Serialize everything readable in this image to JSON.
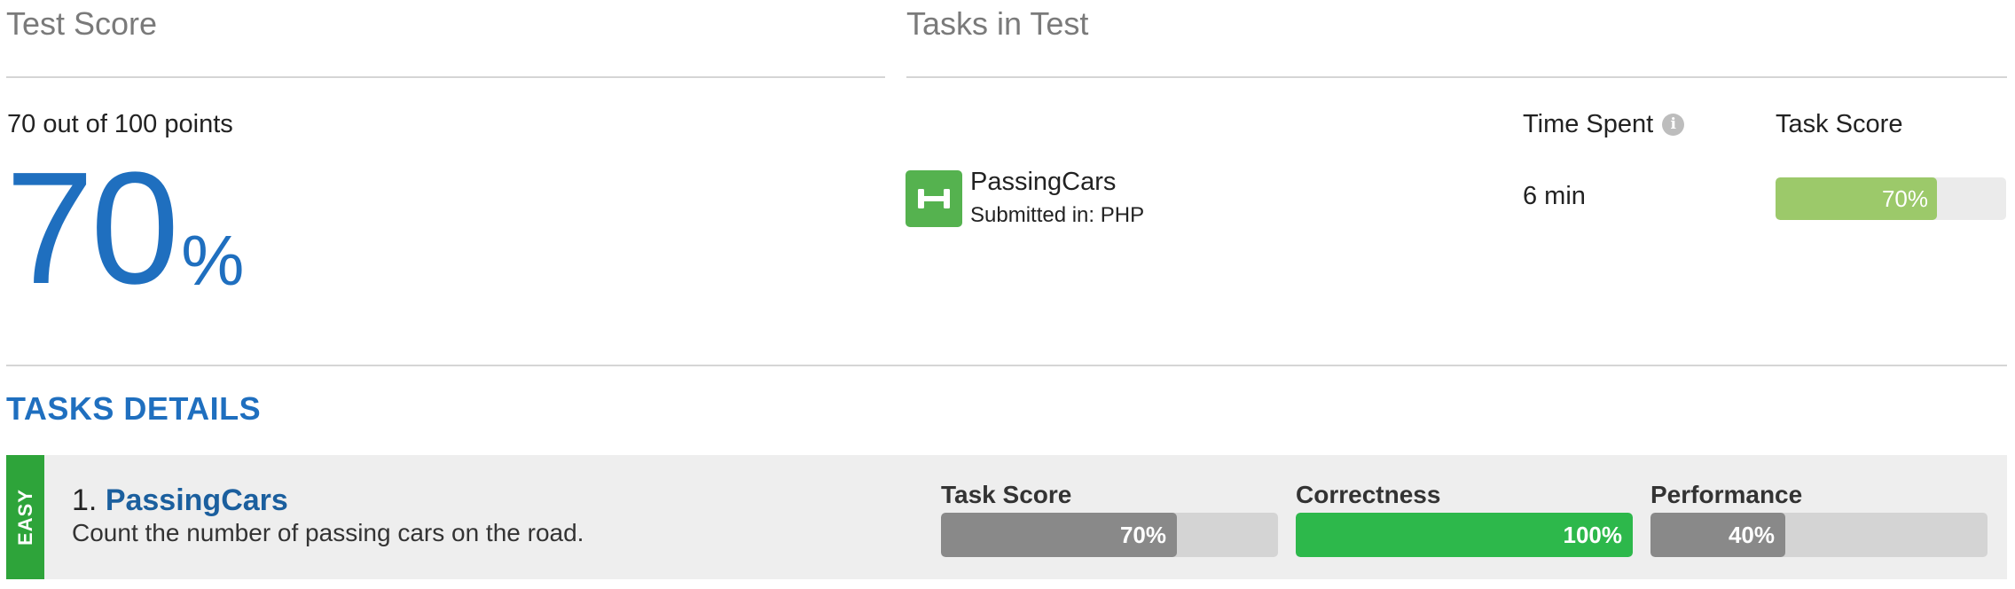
{
  "test_score": {
    "title": "Test Score",
    "points_text": "70 out of 100 points",
    "value": "70",
    "unit": "%",
    "accent_color": "#1f6fbf"
  },
  "tasks_in_test": {
    "title": "Tasks in Test",
    "col_time": "Time Spent",
    "col_score": "Task Score",
    "info_icon": "info-icon",
    "rows": [
      {
        "icon": "dumbbell-icon",
        "icon_color": "#55b24f",
        "name": "PassingCars",
        "submitted": "Submitted in: PHP",
        "time": "6 min",
        "score_label": "70%",
        "score_fraction": 0.7,
        "bar_color": "#9cc96a"
      }
    ]
  },
  "tasks_details": {
    "title": "TASKS DETAILS",
    "items": [
      {
        "difficulty": "EASY",
        "difficulty_color": "#2ea43a",
        "number": "1.",
        "name": "PassingCars",
        "description": "Count the number of passing cars on the road.",
        "metrics": [
          {
            "label": "Task Score",
            "value_label": "70%",
            "fraction": 0.7,
            "color": "#898989"
          },
          {
            "label": "Correctness",
            "value_label": "100%",
            "fraction": 1.0,
            "color": "#2db84b"
          },
          {
            "label": "Performance",
            "value_label": "40%",
            "fraction": 0.4,
            "color": "#898989"
          }
        ]
      }
    ]
  }
}
